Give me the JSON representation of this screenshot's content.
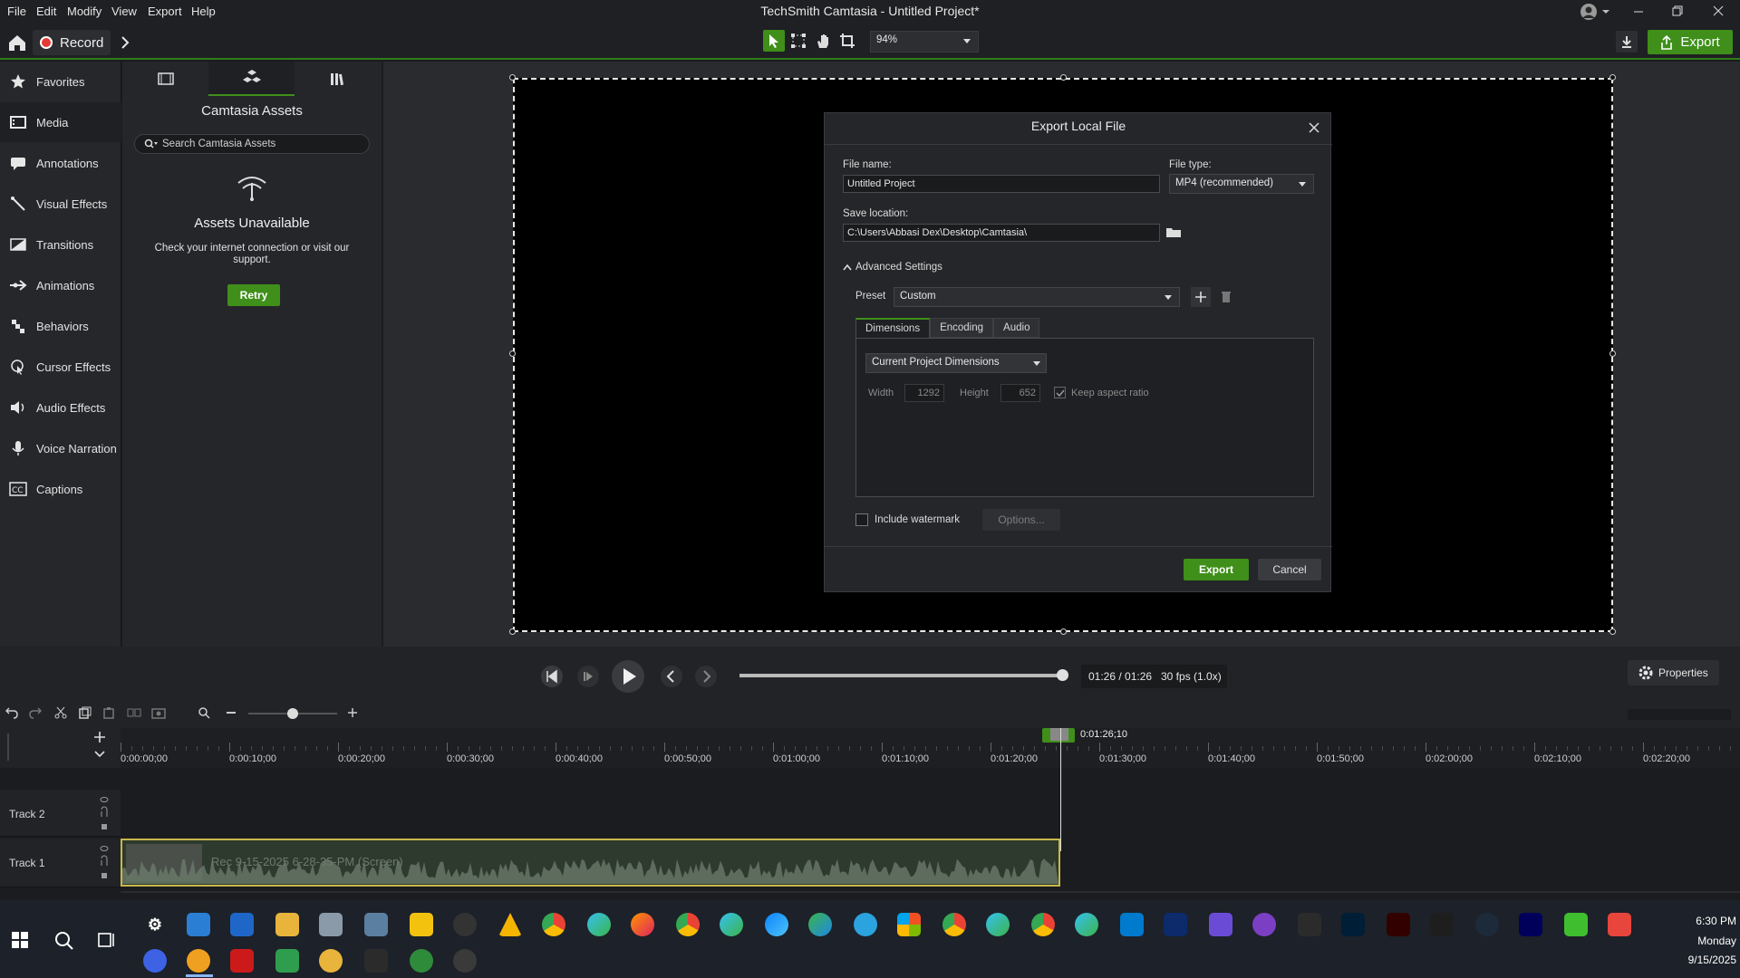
{
  "window": {
    "title": "TechSmith Camtasia - Untitled Project*",
    "menu": [
      "File",
      "Edit",
      "Modify",
      "View",
      "Export",
      "Help"
    ]
  },
  "toolbar": {
    "record_label": "Record",
    "zoom_value": "94%",
    "export_label": "Export"
  },
  "sidebar": {
    "items": [
      {
        "label": "Favorites",
        "icon": "star-icon"
      },
      {
        "label": "Media",
        "icon": "media-icon"
      },
      {
        "label": "Annotations",
        "icon": "annotation-icon"
      },
      {
        "label": "Visual Effects",
        "icon": "wand-icon"
      },
      {
        "label": "Transitions",
        "icon": "transition-icon"
      },
      {
        "label": "Animations",
        "icon": "animation-arrow-icon"
      },
      {
        "label": "Behaviors",
        "icon": "behaviors-icon"
      },
      {
        "label": "Cursor Effects",
        "icon": "cursor-effects-icon"
      },
      {
        "label": "Audio Effects",
        "icon": "speaker-icon"
      },
      {
        "label": "Voice Narration",
        "icon": "microphone-icon"
      },
      {
        "label": "Captions",
        "icon": "cc-icon"
      }
    ]
  },
  "assets": {
    "title": "Camtasia Assets",
    "search_placeholder": "Search Camtasia Assets",
    "unavailable_title": "Assets Unavailable",
    "unavailable_msg": "Check your internet connection or visit our support.",
    "retry_label": "Retry"
  },
  "dialog": {
    "title": "Export Local File",
    "file_name_label": "File name:",
    "file_name_value": "Untitled Project",
    "file_type_label": "File type:",
    "file_type_value": "MP4 (recommended)",
    "save_location_label": "Save location:",
    "save_location_value": "C:\\Users\\Abbasi Dex\\Desktop\\Camtasia\\",
    "advanced_label": "Advanced Settings",
    "preset_label": "Preset",
    "preset_value": "Custom",
    "tabs": [
      "Dimensions",
      "Encoding",
      "Audio"
    ],
    "dimensions_value": "Current Project Dimensions",
    "width_label": "Width",
    "width_value": "1292",
    "height_label": "Height",
    "height_value": "652",
    "keep_aspect_label": "Keep aspect ratio",
    "keep_aspect_checked": true,
    "watermark_label": "Include watermark",
    "watermark_checked": false,
    "options_label": "Options...",
    "export_label": "Export",
    "cancel_label": "Cancel"
  },
  "player": {
    "time_display": "01:26 / 01:26",
    "fps_display": "30 fps (1.0x)",
    "progress": 1.0,
    "properties_label": "Properties"
  },
  "timeline": {
    "playhead_time": "0:01:26;10",
    "ticks": [
      "0:00:00;00",
      "0:00:10;00",
      "0:00:20;00",
      "0:00:30;00",
      "0:00:40;00",
      "0:00:50;00",
      "0:01:00;00",
      "0:01:10;00",
      "0:01:20;00",
      "0:01:30;00",
      "0:01:40;00",
      "0:01:50;00",
      "0:02:00;00",
      "0:02:10;00",
      "0:02:20;00"
    ],
    "tracks": [
      "Track 2",
      "Track 1"
    ],
    "clip_label": "Rec 9-15-2025 6-28-35-PM (Screen)"
  },
  "taskbar": {
    "time": "6:30 PM",
    "day": "Monday",
    "date": "9/15/2025"
  },
  "colors": {
    "accent_green": "#3f8f1a",
    "record_red": "#e53935",
    "clip_border": "#c9b84a"
  }
}
